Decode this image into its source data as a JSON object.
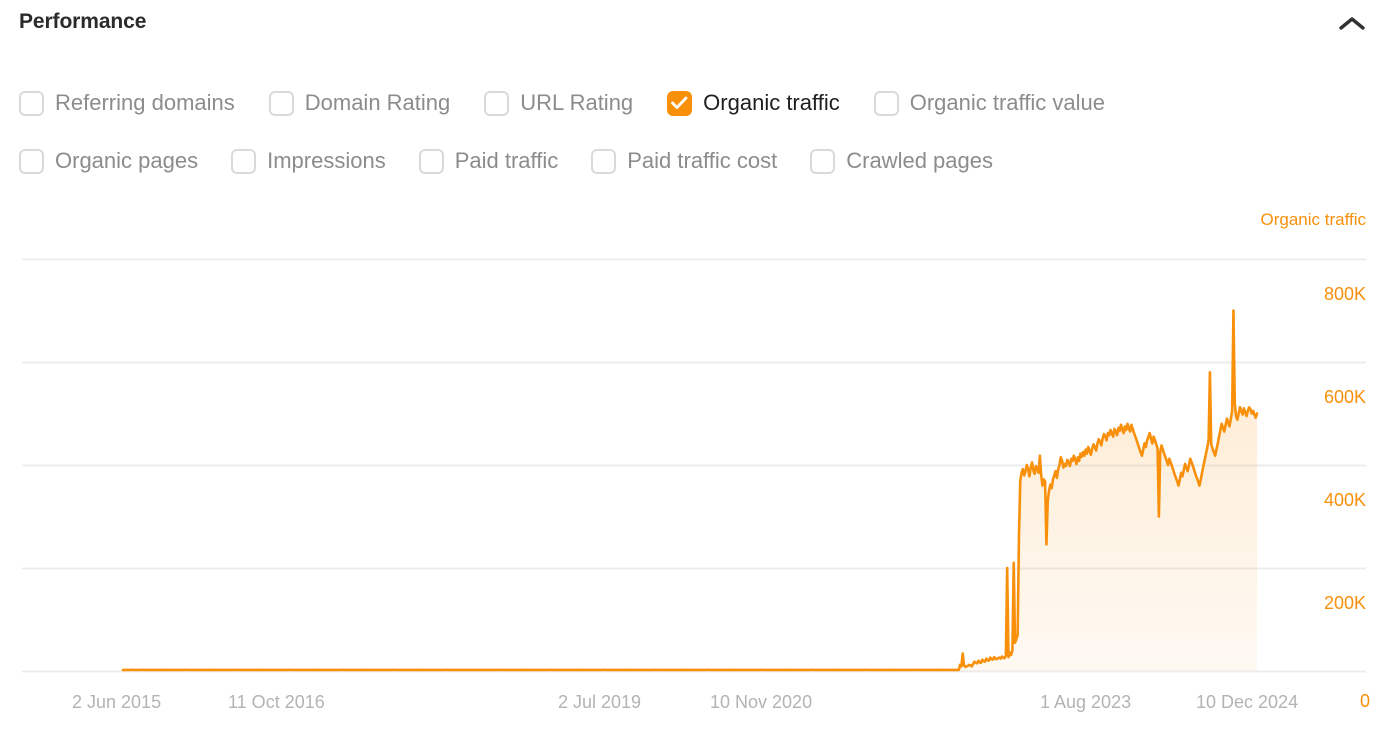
{
  "header": {
    "title": "Performance",
    "collapse_icon": "chevron-up-icon"
  },
  "metrics": {
    "rows": [
      [
        {
          "label": "Referring domains",
          "checked": false
        },
        {
          "label": "Domain Rating",
          "checked": false
        },
        {
          "label": "URL Rating",
          "checked": false
        },
        {
          "label": "Organic traffic",
          "checked": true
        },
        {
          "label": "Organic traffic value",
          "checked": false
        }
      ],
      [
        {
          "label": "Organic pages",
          "checked": false
        },
        {
          "label": "Impressions",
          "checked": false
        },
        {
          "label": "Paid traffic",
          "checked": false
        },
        {
          "label": "Paid traffic cost",
          "checked": false
        },
        {
          "label": "Crawled pages",
          "checked": false
        }
      ]
    ]
  },
  "chart_data": {
    "type": "area",
    "title": "Organic traffic",
    "series_name": "Organic traffic",
    "color": "#F8900C",
    "fill_color": "#FCEBDC",
    "grid": true,
    "legend_position": "top-right",
    "xlabel": "",
    "ylabel": "Organic traffic",
    "ylim": [
      0,
      1000000
    ],
    "ytick_labels": [
      "800K",
      "600K",
      "400K",
      "200K",
      "0"
    ],
    "ytick_values": [
      800000,
      600000,
      400000,
      200000,
      0
    ],
    "xtick_labels": [
      "2 Jun 2015",
      "11 Oct 2016",
      "2 Jul 2019",
      "10 Nov 2020",
      "1 Aug 2023",
      "10 Dec 2024"
    ],
    "x_start": "2 Jun 2015",
    "x_end": "10 Dec 2024",
    "values": [
      2000,
      2100,
      2000,
      2200,
      2100,
      2000,
      2300,
      2200,
      2100,
      2000,
      2100,
      2200,
      2000,
      2100,
      2300,
      2200,
      2100,
      2000,
      2200,
      2100,
      2000,
      2100,
      2200,
      2000,
      2100,
      2200,
      2100,
      2000,
      2200,
      2100,
      2000,
      2100,
      2200,
      2000,
      2300,
      2100,
      2000,
      2200,
      2100,
      2000,
      2200,
      2100,
      2000,
      2100,
      2200,
      2000,
      2100,
      2300,
      2200,
      2100,
      2000,
      2200,
      2100,
      2000,
      2100,
      2200,
      2000,
      2100,
      2200,
      2100,
      2000,
      2200,
      2100,
      2000,
      2100,
      2200,
      2000,
      2300,
      2100,
      2000,
      2200,
      2100,
      2000,
      2100,
      2200,
      2000,
      2100,
      2200,
      2100,
      2000,
      2200,
      2100,
      2000,
      2100,
      2200,
      2000,
      2100,
      2300,
      2200,
      2100,
      2000,
      2200,
      2100,
      2000,
      2100,
      2200,
      2000,
      2100,
      2200,
      2100,
      2000,
      2200,
      2100,
      2000,
      2100,
      2200,
      2000,
      2300,
      2100,
      2000,
      2200,
      2100,
      2000,
      2100,
      2200,
      2000,
      2100,
      2200,
      2100,
      2000,
      2200,
      2100,
      2000,
      2100,
      2200,
      2000,
      2100,
      2300,
      2200,
      2100,
      2000,
      2200,
      2100,
      2000,
      2100,
      2200,
      2000,
      2100,
      2200,
      2100,
      2000,
      2200,
      2100,
      2000,
      2100,
      2200,
      2000,
      2300,
      2100,
      2000,
      2200,
      2100,
      2000,
      2100,
      2200,
      2000,
      2100,
      2200,
      2100,
      2000,
      2200,
      2100,
      2000,
      2100,
      2200,
      2000,
      2100,
      2300,
      2200,
      2100,
      2000,
      2200,
      2100,
      2000,
      2100,
      2200,
      2000,
      2100,
      2200,
      2100,
      2000,
      2200,
      2100,
      2000,
      2100,
      2200,
      2000,
      2300,
      2100,
      2000,
      2200,
      2100,
      2000,
      2100,
      2200,
      2000,
      2100,
      2200,
      2100,
      2000,
      2200,
      2100,
      2000,
      2100,
      2200,
      2000,
      2100,
      2300,
      2200,
      2100,
      2000,
      2200,
      2100,
      2000,
      2100,
      2200,
      2000,
      2100,
      2200,
      2100,
      2000,
      2200,
      2100,
      2000,
      2100,
      2200,
      2000,
      2300,
      2100,
      2000,
      2200,
      2100,
      2000,
      2100,
      2200,
      2000,
      2100,
      2200,
      2100,
      2000,
      2200,
      2100,
      2000,
      2100,
      2200,
      2000,
      2100,
      2300,
      2200,
      2100,
      2000,
      2200,
      2100,
      2000,
      2100,
      2200,
      2000,
      2100,
      2200,
      2100,
      2000,
      2200,
      2100,
      2000,
      2100,
      2200,
      2000,
      2300,
      2100,
      2000,
      2200,
      2100,
      2000,
      2100,
      2200,
      2000,
      2100,
      2200,
      2100,
      2000,
      2200,
      2100,
      2000,
      2100,
      2200,
      2000,
      2100,
      2300,
      2200,
      2100,
      2000,
      2200,
      2100,
      2000,
      2100,
      2200,
      2000,
      2100,
      2200,
      2100,
      2000,
      2200,
      2100,
      2000,
      2100,
      2200,
      2000,
      2300,
      2100,
      2000,
      2200,
      2100,
      2000,
      2100,
      2200,
      2000,
      2100,
      2200,
      2100,
      2000,
      2200,
      2100,
      2000,
      2100,
      2200,
      2000,
      2100,
      2300,
      2200,
      2100,
      2000,
      2200,
      2100,
      2000,
      2100,
      2200,
      2000,
      2100,
      2200,
      2100,
      2000,
      2200,
      2100,
      2000,
      2100,
      2200,
      2000,
      2300,
      2100,
      2000,
      2200,
      2100,
      2000,
      2100,
      2200,
      2000,
      2100,
      2200,
      2100,
      2000,
      2200,
      2100,
      2000,
      2100,
      2200,
      2000,
      2100,
      2300,
      2200,
      2100,
      2000,
      2200,
      2100,
      2000,
      2100,
      2200,
      2000,
      2100,
      2200,
      2100,
      2000,
      2200,
      2100,
      2000,
      2100,
      2200,
      2000,
      2300,
      2100,
      2000,
      2200,
      2100,
      2000,
      2100,
      2200,
      2000,
      2100,
      2200,
      2100,
      2000,
      2200,
      2100,
      2000,
      2100,
      2200,
      2000,
      2100,
      2300,
      2200,
      2100,
      2000,
      2200,
      2100,
      2000,
      2100,
      2200,
      2000,
      2100,
      2200,
      2100,
      2000,
      2200,
      2100,
      2000,
      2100,
      2200,
      2000,
      2300,
      2100,
      2000,
      2200,
      2100,
      2000,
      2100,
      2200,
      2000,
      2100,
      2200,
      2100,
      2000,
      2200,
      2100,
      2000,
      2100,
      2200,
      2000,
      2100,
      2300,
      2200,
      2100,
      2000,
      2200,
      2100,
      2000,
      2100,
      2200,
      2000,
      2100,
      2200,
      2100,
      2000,
      2200,
      2100,
      2000,
      2100,
      2200,
      2000,
      2300,
      2100,
      2000,
      2200,
      2100,
      2000,
      2100,
      2200,
      2000,
      2100,
      2200,
      2100,
      2000,
      2200,
      2100,
      2000,
      2100,
      2200,
      2000,
      2100,
      2300,
      2200,
      2100,
      2000,
      2200,
      2100,
      2000,
      2100,
      2200,
      2000,
      2100,
      2200,
      2100,
      2000,
      2200,
      2100,
      2000,
      2100,
      2200,
      2000,
      2300,
      2100,
      2000,
      2200,
      2100,
      2000,
      2100,
      2200,
      2000,
      2100,
      2200,
      2100,
      2000,
      2200,
      2100,
      2000,
      2100,
      2200,
      2000,
      2100,
      2300,
      2200,
      2100,
      2000,
      2200,
      2100,
      2000,
      2100,
      2200,
      2000,
      2100,
      2200,
      2100,
      2000,
      2200,
      2100,
      2000,
      2100,
      2200,
      2000,
      2300,
      2100,
      2000,
      2200,
      2100,
      2000,
      2100,
      2200,
      2000,
      2100,
      2200,
      2100,
      2000,
      2200,
      2100,
      2000,
      2100,
      2200,
      2000,
      2100,
      2300,
      2200,
      2100,
      2000,
      2200,
      2100,
      2000,
      2100,
      2200,
      2000,
      2100,
      2200,
      2100,
      2000,
      2200,
      2100,
      2000,
      2100,
      2200,
      2000,
      2300,
      2100,
      2000,
      2200,
      2100,
      2000,
      2100,
      2200,
      2000,
      2100,
      2200,
      2100,
      2000,
      2200,
      2100,
      2000,
      2100,
      2200,
      2000,
      2100,
      2300,
      2200,
      2100,
      2000,
      2200,
      2100,
      2000,
      2100,
      2200,
      2000,
      2100,
      2200,
      2100,
      2000,
      2200,
      2100,
      2000,
      2100,
      2200,
      2000,
      2300,
      2100,
      2000,
      2200,
      2100,
      2000,
      2100,
      2200,
      2000,
      2100,
      2200,
      2100,
      2000,
      12000,
      9000,
      34000,
      11000,
      8000,
      9000,
      10000,
      12000,
      11000,
      9000,
      14000,
      18000,
      16000,
      15000,
      20000,
      17000,
      16000,
      22000,
      19000,
      18000,
      24000,
      21000,
      20000,
      26000,
      23000,
      22000,
      27000,
      24000,
      23000,
      25000,
      26000,
      24000,
      28000,
      26000,
      25000,
      30000,
      200000,
      27000,
      36000,
      31000,
      40000,
      210000,
      55000,
      62000,
      70000,
      260000,
      370000,
      385000,
      392000,
      380000,
      388000,
      400000,
      392000,
      378000,
      395000,
      405000,
      390000,
      383000,
      398000,
      392000,
      385000,
      418000,
      380000,
      360000,
      372000,
      368000,
      246000,
      330000,
      350000,
      362000,
      355000,
      372000,
      380000,
      388000,
      375000,
      392000,
      400000,
      415000,
      408000,
      395000,
      402000,
      398000,
      410000,
      405000,
      398000,
      412000,
      408000,
      418000,
      410000,
      402000,
      415000,
      408000,
      422000,
      416000,
      425000,
      418000,
      430000,
      422000,
      435000,
      428000,
      420000,
      432000,
      440000,
      435000,
      428000,
      442000,
      450000,
      445000,
      438000,
      452000,
      460000,
      455000,
      448000,
      462000,
      458000,
      468000,
      462000,
      455000,
      470000,
      465000,
      458000,
      472000,
      466000,
      478000,
      470000,
      462000,
      475000,
      468000,
      480000,
      472000,
      465000,
      478000,
      470000,
      462000,
      455000,
      448000,
      440000,
      432000,
      425000,
      418000,
      430000,
      442000,
      435000,
      448000,
      455000,
      462000,
      450000,
      442000,
      455000,
      448000,
      440000,
      432000,
      300000,
      425000,
      438000,
      430000,
      422000,
      415000,
      408000,
      400000,
      412000,
      405000,
      398000,
      390000,
      382000,
      375000,
      368000,
      360000,
      372000,
      385000,
      378000,
      390000,
      402000,
      395000,
      388000,
      400000,
      412000,
      405000,
      398000,
      390000,
      382000,
      375000,
      368000,
      360000,
      372000,
      385000,
      398000,
      410000,
      422000,
      435000,
      448000,
      580000,
      440000,
      432000,
      425000,
      418000,
      430000,
      442000,
      455000,
      468000,
      480000,
      472000,
      465000,
      478000,
      490000,
      482000,
      475000,
      490000,
      505000,
      700000,
      520000,
      495000,
      488000,
      500000,
      512000,
      505000,
      498000,
      510000,
      502000,
      495000,
      505000,
      512000,
      508000,
      500000,
      505000,
      498000,
      492000,
      500000
    ],
    "notes": "Flat near-zero until late 2020, sharp ramp to ~400K, gradual climb to ~490K, final spike near 700K"
  }
}
